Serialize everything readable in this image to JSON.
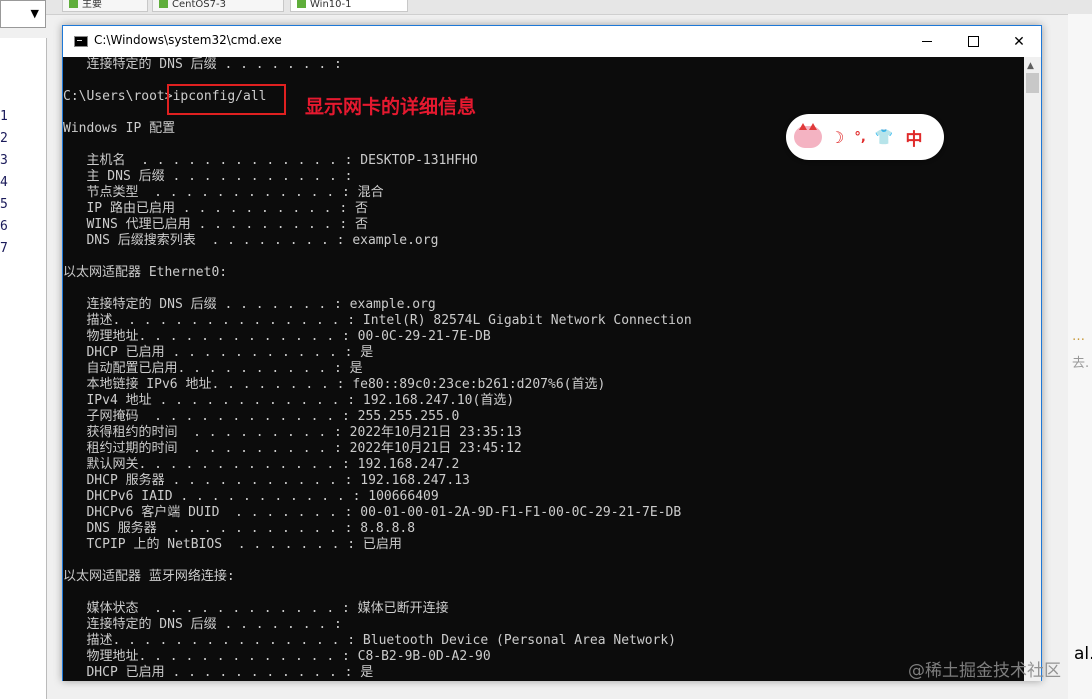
{
  "background": {
    "tabs": [
      "主要",
      "CentOS7-3",
      "Win10-1"
    ],
    "line_numbers": [
      "1",
      "2",
      "3",
      "4",
      "5",
      "6",
      "7"
    ],
    "right_snippets": [
      "al.",
      "去."
    ]
  },
  "window": {
    "title": "C:\\Windows\\system32\\cmd.exe"
  },
  "console": {
    "lines": [
      "   连接特定的 DNS 后缀 . . . . . . . :",
      "",
      "C:\\Users\\root>ipconfig/all",
      "",
      "Windows IP 配置",
      "",
      "   主机名  . . . . . . . . . . . . . : DESKTOP-131HFHO",
      "   主 DNS 后缀 . . . . . . . . . . . :",
      "   节点类型  . . . . . . . . . . . . : 混合",
      "   IP 路由已启用 . . . . . . . . . . : 否",
      "   WINS 代理已启用 . . . . . . . . . : 否",
      "   DNS 后缀搜索列表  . . . . . . . . : example.org",
      "",
      "以太网适配器 Ethernet0:",
      "",
      "   连接特定的 DNS 后缀 . . . . . . . : example.org",
      "   描述. . . . . . . . . . . . . . . : Intel(R) 82574L Gigabit Network Connection",
      "   物理地址. . . . . . . . . . . . . : 00-0C-29-21-7E-DB",
      "   DHCP 已启用 . . . . . . . . . . . : 是",
      "   自动配置已启用. . . . . . . . . . : 是",
      "   本地链接 IPv6 地址. . . . . . . . : fe80::89c0:23ce:b261:d207%6(首选)",
      "   IPv4 地址 . . . . . . . . . . . . : 192.168.247.10(首选)",
      "   子网掩码  . . . . . . . . . . . . : 255.255.255.0",
      "   获得租约的时间  . . . . . . . . . : 2022年10月21日 23:35:13",
      "   租约过期的时间  . . . . . . . . . : 2022年10月21日 23:45:12",
      "   默认网关. . . . . . . . . . . . . : 192.168.247.2",
      "   DHCP 服务器 . . . . . . . . . . . : 192.168.247.13",
      "   DHCPv6 IAID . . . . . . . . . . . : 100666409",
      "   DHCPv6 客户端 DUID  . . . . . . . : 00-01-00-01-2A-9D-F1-F1-00-0C-29-21-7E-DB",
      "   DNS 服务器  . . . . . . . . . . . : 8.8.8.8",
      "   TCPIP 上的 NetBIOS  . . . . . . . : 已启用",
      "",
      "以太网适配器 蓝牙网络连接:",
      "",
      "   媒体状态  . . . . . . . . . . . . : 媒体已断开连接",
      "   连接特定的 DNS 后缀 . . . . . . . :",
      "   描述. . . . . . . . . . . . . . . : Bluetooth Device (Personal Area Network)",
      "   物理地址. . . . . . . . . . . . . : C8-B2-9B-0D-A2-90",
      "   DHCP 已启用 . . . . . . . . . . . : 是"
    ]
  },
  "annotation": {
    "text": "显示网卡的详细信息",
    "color": "#e5192f"
  },
  "ime": {
    "mode_label": "中",
    "punct_label": "°,"
  },
  "watermark": "@稀土掘金技术社区",
  "colors": {
    "console_bg": "#0c0c0c",
    "console_text": "#cccccc",
    "window_border": "#1e78d7"
  }
}
